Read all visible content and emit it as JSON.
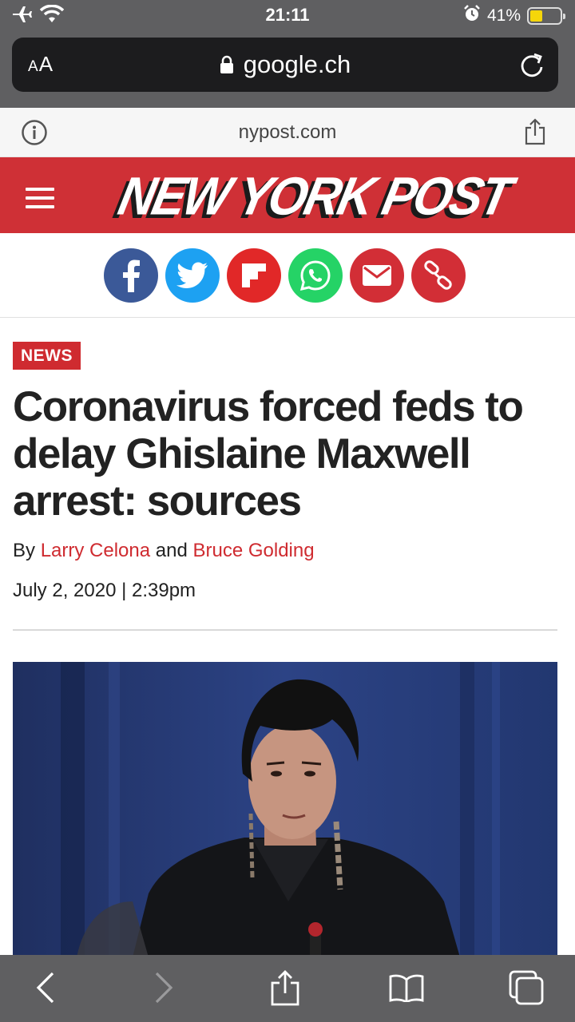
{
  "status_bar": {
    "time": "21:11",
    "battery_percent": "41%",
    "battery_level": 0.41
  },
  "browser": {
    "text_size_label_small": "A",
    "text_size_label_large": "A",
    "url": "google.ch",
    "site_domain": "nypost.com"
  },
  "site_header": {
    "logo_text": "NEW YORK POST",
    "brand_color": "#cf3036"
  },
  "share_buttons": [
    {
      "name": "facebook",
      "color": "#3b5998"
    },
    {
      "name": "twitter",
      "color": "#1da1f2"
    },
    {
      "name": "flipboard",
      "color": "#e12828"
    },
    {
      "name": "whatsapp",
      "color": "#25d366"
    },
    {
      "name": "email",
      "color": "#d22e36"
    },
    {
      "name": "copy-link",
      "color": "#d22e36"
    }
  ],
  "article": {
    "section_tag": "NEWS",
    "headline": "Coronavirus forced feds to delay Ghislaine Maxwell arrest: sources",
    "by_prefix": "By",
    "author_1": "Larry Celona",
    "author_joiner": "and",
    "author_2": "Bruce Golding",
    "date": "July 2, 2020 | 2:39pm"
  },
  "toolbar": {
    "icons": [
      "back-icon",
      "forward-icon",
      "share-icon",
      "bookmarks-icon",
      "tabs-icon"
    ]
  }
}
